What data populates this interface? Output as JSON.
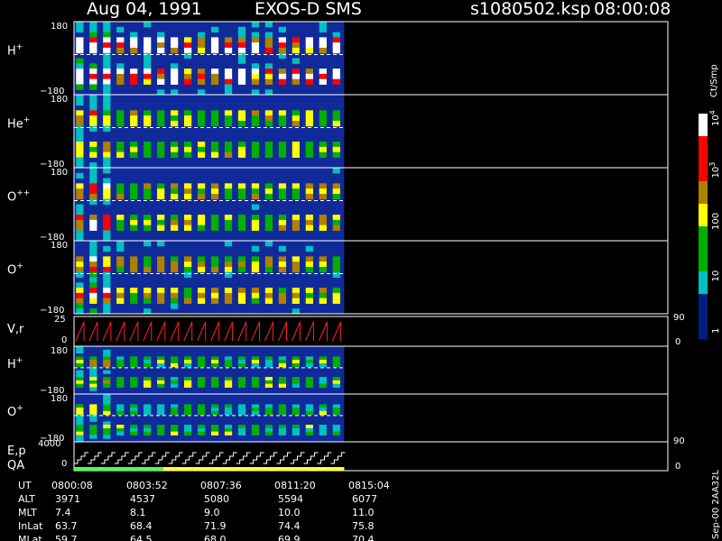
{
  "header": {
    "date": "Aug 04, 1991",
    "instrument": "EXOS-D SMS",
    "file": "s1080502.ksp",
    "time": "08:00:08"
  },
  "colorbar": {
    "unit": "Ct/Smp",
    "ticks": [
      "1",
      "10",
      "100",
      "10",
      "10"
    ],
    "exponents": [
      "",
      "",
      "",
      "3",
      "4"
    ],
    "stops": [
      "#ffffff",
      "#ff0000",
      "#b08000",
      "#ffff00",
      "#00b000",
      "#00c0c0",
      "#002080"
    ]
  },
  "chart_data": {
    "type": "heatmap",
    "panels": [
      {
        "label": "H",
        "charge": "+",
        "ymax": "180",
        "ymin": "−180",
        "intensity": 0.7
      },
      {
        "label": "He",
        "charge": "+",
        "ymax": "180",
        "ymin": "−180",
        "intensity": 0.4
      },
      {
        "label": "O",
        "charge": "++",
        "ymax": "180",
        "ymin": "−180",
        "intensity": 0.45
      },
      {
        "label": "O",
        "charge": "+",
        "ymax": "180",
        "ymin": "−180",
        "intensity": 0.5
      }
    ],
    "vr_panel": {
      "label": "V,r",
      "ymax": "25",
      "ymin": "0",
      "right_max": "90",
      "right_min": "0"
    },
    "lower_panels": [
      {
        "label": "H",
        "charge": "+",
        "ymax": "180",
        "ymin": "−180",
        "intensity": 0.3
      },
      {
        "label": "O",
        "charge": "+",
        "ymax": "180",
        "ymin": "−180",
        "intensity": 0.25
      }
    ],
    "ep_panel": {
      "label1": "E,p",
      "label2": "QA",
      "ymax": "4000",
      "ymin": "0",
      "right_max": "90",
      "right_min": "0"
    },
    "data_end_fraction": 0.455,
    "cycles": 20,
    "orbit_table": {
      "rows": [
        {
          "name": "UT",
          "values": [
            "0800:08",
            "0803:52",
            "0807:36",
            "0811:20",
            "0815:04"
          ]
        },
        {
          "name": "ALT",
          "values": [
            "3971",
            "4537",
            "5080",
            "5594",
            "6077"
          ]
        },
        {
          "name": "MLT",
          "values": [
            "7.4",
            "8.1",
            "9.0",
            "10.0",
            "11.0"
          ]
        },
        {
          "name": "InLat",
          "values": [
            "63.7",
            "68.4",
            "71.9",
            "74.4",
            "75.8"
          ]
        },
        {
          "name": "MLat",
          "values": [
            "59.7",
            "64.5",
            "68.0",
            "69.9",
            "70.4"
          ]
        }
      ]
    }
  },
  "side_note": "Sep-00 2AA32L"
}
